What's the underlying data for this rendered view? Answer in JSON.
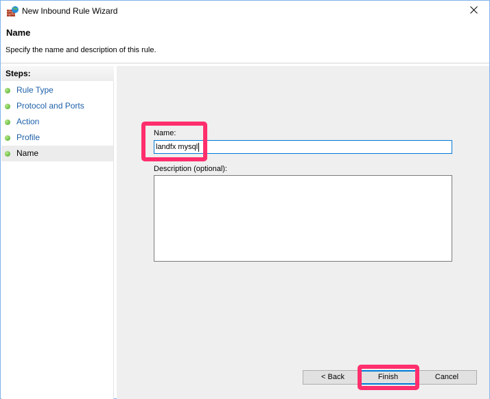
{
  "window": {
    "title": "New Inbound Rule Wizard",
    "icon": "firewall-icon",
    "close_icon": "close-icon"
  },
  "header": {
    "title": "Name",
    "subtitle": "Specify the name and description of this rule."
  },
  "steps": {
    "heading": "Steps:",
    "items": [
      {
        "label": "Rule Type",
        "state": "link"
      },
      {
        "label": "Protocol and Ports",
        "state": "link"
      },
      {
        "label": "Action",
        "state": "link"
      },
      {
        "label": "Profile",
        "state": "link"
      },
      {
        "label": "Name",
        "state": "current"
      }
    ]
  },
  "form": {
    "name_label": "Name:",
    "name_value": "landfx mysql",
    "description_label": "Description (optional):",
    "description_value": ""
  },
  "buttons": {
    "back": "< Back",
    "finish": "Finish",
    "cancel": "Cancel"
  },
  "colors": {
    "accent": "#0078d7",
    "highlight": "#ff2e6c",
    "link": "#1c5fa8",
    "step_dot": "#47a51d"
  }
}
